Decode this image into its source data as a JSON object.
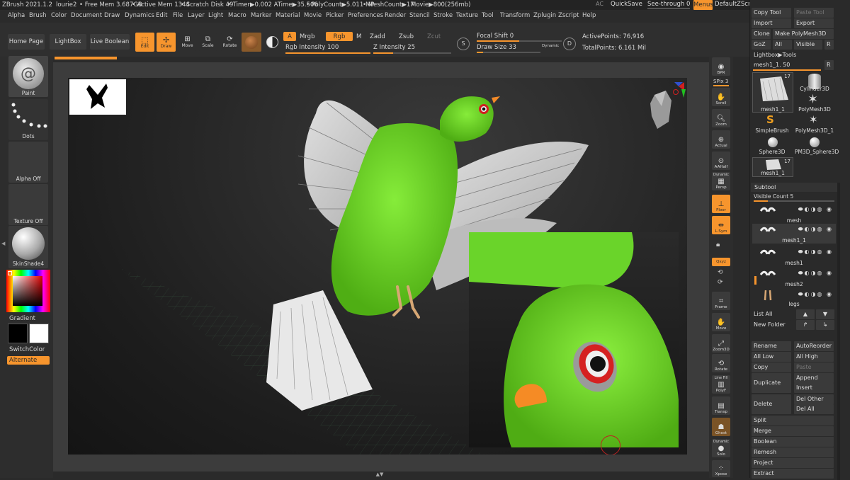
{
  "titlebar": {
    "app": "ZBrush 2021.1.2",
    "user": "lourie2",
    "free_mem": "• Free Mem 3.687GB",
    "active_mem": "• Active Mem 1344",
    "scratch": "• Scratch Disk 49",
    "timer": "• Timer▶0.002 ATime▶35.506",
    "polycount": "• PolyCount▶5.011 MP",
    "meshcount": "• MeshCount▶17",
    "movie": "Movie▶800(256mb)",
    "ac": "AC",
    "quicksave": "QuickSave",
    "seethrough": "See-through",
    "seethrough_val": "0",
    "menus": "Menus",
    "script": "DefaultZScript"
  },
  "menu": [
    "Alpha",
    "Brush",
    "Color",
    "Document",
    "Draw",
    "Dynamics",
    "Edit",
    "File",
    "Layer",
    "Light",
    "Macro",
    "Marker",
    "Material",
    "Movie",
    "Picker",
    "Preferences",
    "Render",
    "Stencil",
    "Stroke",
    "Texture",
    "Tool",
    "Transform",
    "Zplugin",
    "Zscript",
    "Help"
  ],
  "toolbar": {
    "home": "Home Page",
    "lightbox": "LightBox",
    "liveboolean": "Live Boolean",
    "edit": "Edit",
    "draw": "Draw",
    "move": "Move",
    "scale": "Scale",
    "rotate": "Rotate",
    "a": "A",
    "mrgb": "Mrgb",
    "rgb": "Rgb",
    "m": "M",
    "zadd": "Zadd",
    "zsub": "Zsub",
    "zcut": "Zcut",
    "rgb_intensity_label": "Rgb Intensity",
    "rgb_intensity": "100",
    "z_intensity_label": "Z Intensity",
    "z_intensity": "25",
    "focal_label": "Focal Shift",
    "focal": "0",
    "drawsize_label": "Draw Size",
    "drawsize": "33",
    "dynamic": "Dynamic",
    "active_points": "ActivePoints: 76,916",
    "total_points": "TotalPoints: 6.161 Mil",
    "s_key": "S",
    "d_key": "D"
  },
  "left": {
    "paint": "Paint",
    "dots": "Dots",
    "alpha": "Alpha Off",
    "texture": "Texture Off",
    "material": "SkinShade4",
    "gradient": "Gradient",
    "switchcolor": "SwitchColor",
    "alternate": "Alternate"
  },
  "right_shelf": {
    "bpr": "BPR",
    "spix": "SPix 3",
    "scroll": "Scroll",
    "zoom": "Zoom",
    "actual": "Actual",
    "aahalf": "AAHalf",
    "dynamic": "Dynamic",
    "persp": "Persp",
    "floor": "Floor",
    "lsym": "L.Sym",
    "xyz": "Qxyz",
    "frame": "Frame",
    "move": "Move",
    "zoom3d": "Zoom3D",
    "rotate": "Rotate",
    "linefill": "Line Fill",
    "polyf": "PolyF",
    "transp": "Transp",
    "ghost": "Ghost",
    "dynamic2": "Dynamic",
    "solo": "Solo",
    "xpose": "Xpose"
  },
  "tool": {
    "copy_tool": "Copy Tool",
    "paste_tool": "Paste Tool",
    "import": "Import",
    "export": "Export",
    "clone": "Clone",
    "make_polymesh": "Make PolyMesh3D",
    "goz": "GoZ",
    "all": "All",
    "visible": "Visible",
    "r": "R",
    "lightbox_tools": "Lightbox▶Tools",
    "current": "mesh1_1. 50",
    "r2": "R",
    "thumbs": [
      {
        "name": "mesh1_1",
        "count": "17"
      },
      {
        "name": "Cylinder3D",
        "count": ""
      },
      {
        "name": "PolyMesh3D",
        "count": ""
      },
      {
        "name": "SimpleBrush",
        "count": ""
      },
      {
        "name": "PolyMesh3D_1",
        "count": ""
      },
      {
        "name": "Sphere3D",
        "count": ""
      },
      {
        "name": "PM3D_Sphere3D",
        "count": ""
      },
      {
        "name": "mesh1_1",
        "count": "17"
      }
    ]
  },
  "subtool": {
    "header": "Subtool",
    "visible_count": "Visible Count 5",
    "items": [
      "mesh",
      "mesh1_1",
      "mesh1",
      "mesh2",
      "legs"
    ],
    "list_all": "List All",
    "new_folder": "New Folder",
    "rename": "Rename",
    "autoreorder": "AutoReorder",
    "all_low": "All Low",
    "all_high": "All High",
    "copy": "Copy",
    "paste": "Paste",
    "duplicate": "Duplicate",
    "append": "Append",
    "insert": "Insert",
    "delete": "Delete",
    "del_other": "Del Other",
    "del_all": "Del All",
    "split": "Split",
    "merge": "Merge",
    "boolean": "Boolean",
    "remesh": "Remesh",
    "project": "Project",
    "extract": "Extract"
  },
  "colors": {
    "accent": "#f7952d",
    "bird_green": "#6fd42a",
    "feather_gray": "#c8c8c8"
  }
}
